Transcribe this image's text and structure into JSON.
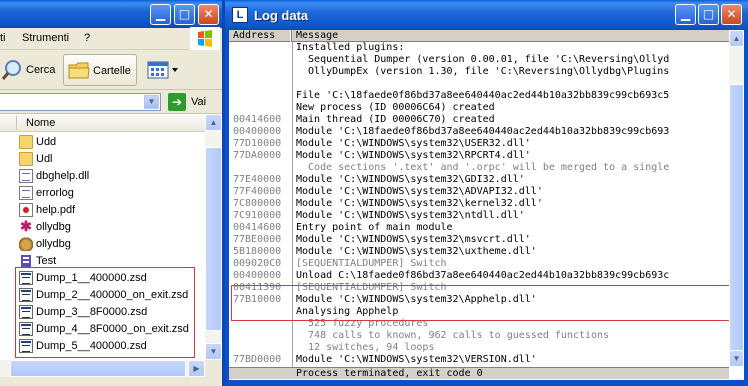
{
  "explorer": {
    "menu": [
      "ti",
      "Strumenti",
      "?"
    ],
    "toolbar": {
      "search_label": "Cerca",
      "folders_label": "Cartelle"
    },
    "address": {
      "go_label": "Vai"
    },
    "column_header": "Nome",
    "files": [
      {
        "name": "Udd",
        "icon": "folder-icon"
      },
      {
        "name": "Udl",
        "icon": "folder-icon"
      },
      {
        "name": "dbghelp.dll",
        "icon": "dll-file-icon"
      },
      {
        "name": "errorlog",
        "icon": "text-file-icon"
      },
      {
        "name": "help.pdf",
        "icon": "pdf-file-icon"
      },
      {
        "name": "ollydbg",
        "icon": "ollydbg-app-icon"
      },
      {
        "name": "ollydbg",
        "icon": "ollydbg-ini-icon"
      },
      {
        "name": "Test",
        "icon": "test-app-icon"
      },
      {
        "name": "Dump_1__400000.zsd",
        "icon": "zsd-file-icon"
      },
      {
        "name": "Dump_2__400000_on_exit.zsd",
        "icon": "zsd-file-icon"
      },
      {
        "name": "Dump_3__8F0000.zsd",
        "icon": "zsd-file-icon"
      },
      {
        "name": "Dump_4__8F0000_on_exit.zsd",
        "icon": "zsd-file-icon"
      },
      {
        "name": "Dump_5__400000.zsd",
        "icon": "zsd-file-icon"
      }
    ]
  },
  "log": {
    "title": "Log data",
    "icon_letter": "L",
    "columns": {
      "address": "Address",
      "message": "Message"
    },
    "rows": [
      {
        "address": "",
        "message": "Installed plugins:",
        "dim": false
      },
      {
        "address": "",
        "message": "  Sequential Dumper (version 0.00.01, file 'C:\\Reversing\\Ollyd",
        "dim": false
      },
      {
        "address": "",
        "message": "  OllyDumpEx (version 1.30, file 'C:\\Reversing\\Ollydbg\\Plugins",
        "dim": false
      },
      {
        "address": "",
        "message": "",
        "dim": false
      },
      {
        "address": "",
        "message": "File 'C:\\18faede0f86bd37a8ee640440ac2ed44b10a32bb839c99cb693c5",
        "dim": false
      },
      {
        "address": "",
        "message": "New process (ID 00006C64) created",
        "dim": false
      },
      {
        "address": "00414600",
        "message": "Main thread (ID 00006C70) created",
        "dim": false
      },
      {
        "address": "00400000",
        "message": "Module 'C:\\18faede0f86bd37a8ee640440ac2ed44b10a32bb839c99cb693",
        "dim": false
      },
      {
        "address": "77D10000",
        "message": "Module 'C:\\WINDOWS\\system32\\USER32.dll'",
        "dim": false
      },
      {
        "address": "77DA0000",
        "message": "Module 'C:\\WINDOWS\\system32\\RPCRT4.dll'",
        "dim": false
      },
      {
        "address": "",
        "message": "  Code sections '.text' and '.orpc' will be merged to a single",
        "dim": true
      },
      {
        "address": "77E40000",
        "message": "Module 'C:\\WINDOWS\\system32\\GDI32.dll'",
        "dim": false
      },
      {
        "address": "77F40000",
        "message": "Module 'C:\\WINDOWS\\system32\\ADVAPI32.dll'",
        "dim": false
      },
      {
        "address": "7C800000",
        "message": "Module 'C:\\WINDOWS\\system32\\kernel32.dll'",
        "dim": false
      },
      {
        "address": "7C910000",
        "message": "Module 'C:\\WINDOWS\\system32\\ntdll.dll'",
        "dim": false
      },
      {
        "address": "00414600",
        "message": "Entry point of main module",
        "dim": false
      },
      {
        "address": "77BE0000",
        "message": "Module 'C:\\WINDOWS\\system32\\msvcrt.dll'",
        "dim": false
      },
      {
        "address": "5B180000",
        "message": "Module 'C:\\WINDOWS\\system32\\uxtheme.dll'",
        "dim": false
      },
      {
        "address": "009020C0",
        "message": "[SEQUENTIALDUMPER] Switch",
        "dim": true
      },
      {
        "address": "00400000",
        "message": "Unload C:\\18faede0f86bd37a8ee640440ac2ed44b10a32bb839c99cb693c",
        "dim": false
      },
      {
        "address": "00411390",
        "message": "[SEQUENTIALDUMPER] Switch",
        "dim": true
      },
      {
        "address": "77B10000",
        "message": "Module 'C:\\WINDOWS\\system32\\Apphelp.dll'",
        "dim": false
      },
      {
        "address": "",
        "message": "Analysing Apphelp",
        "dim": false
      },
      {
        "address": "",
        "message": "  525 fuzzy procedures",
        "dim": true
      },
      {
        "address": "",
        "message": "  748 calls to known, 962 calls to guessed functions",
        "dim": true
      },
      {
        "address": "",
        "message": "  12 switches, 94 loops",
        "dim": true
      },
      {
        "address": "77BD0000",
        "message": "Module 'C:\\WINDOWS\\system32\\VERSION.dll'",
        "dim": false
      }
    ],
    "status": "Process terminated, exit code 0"
  }
}
